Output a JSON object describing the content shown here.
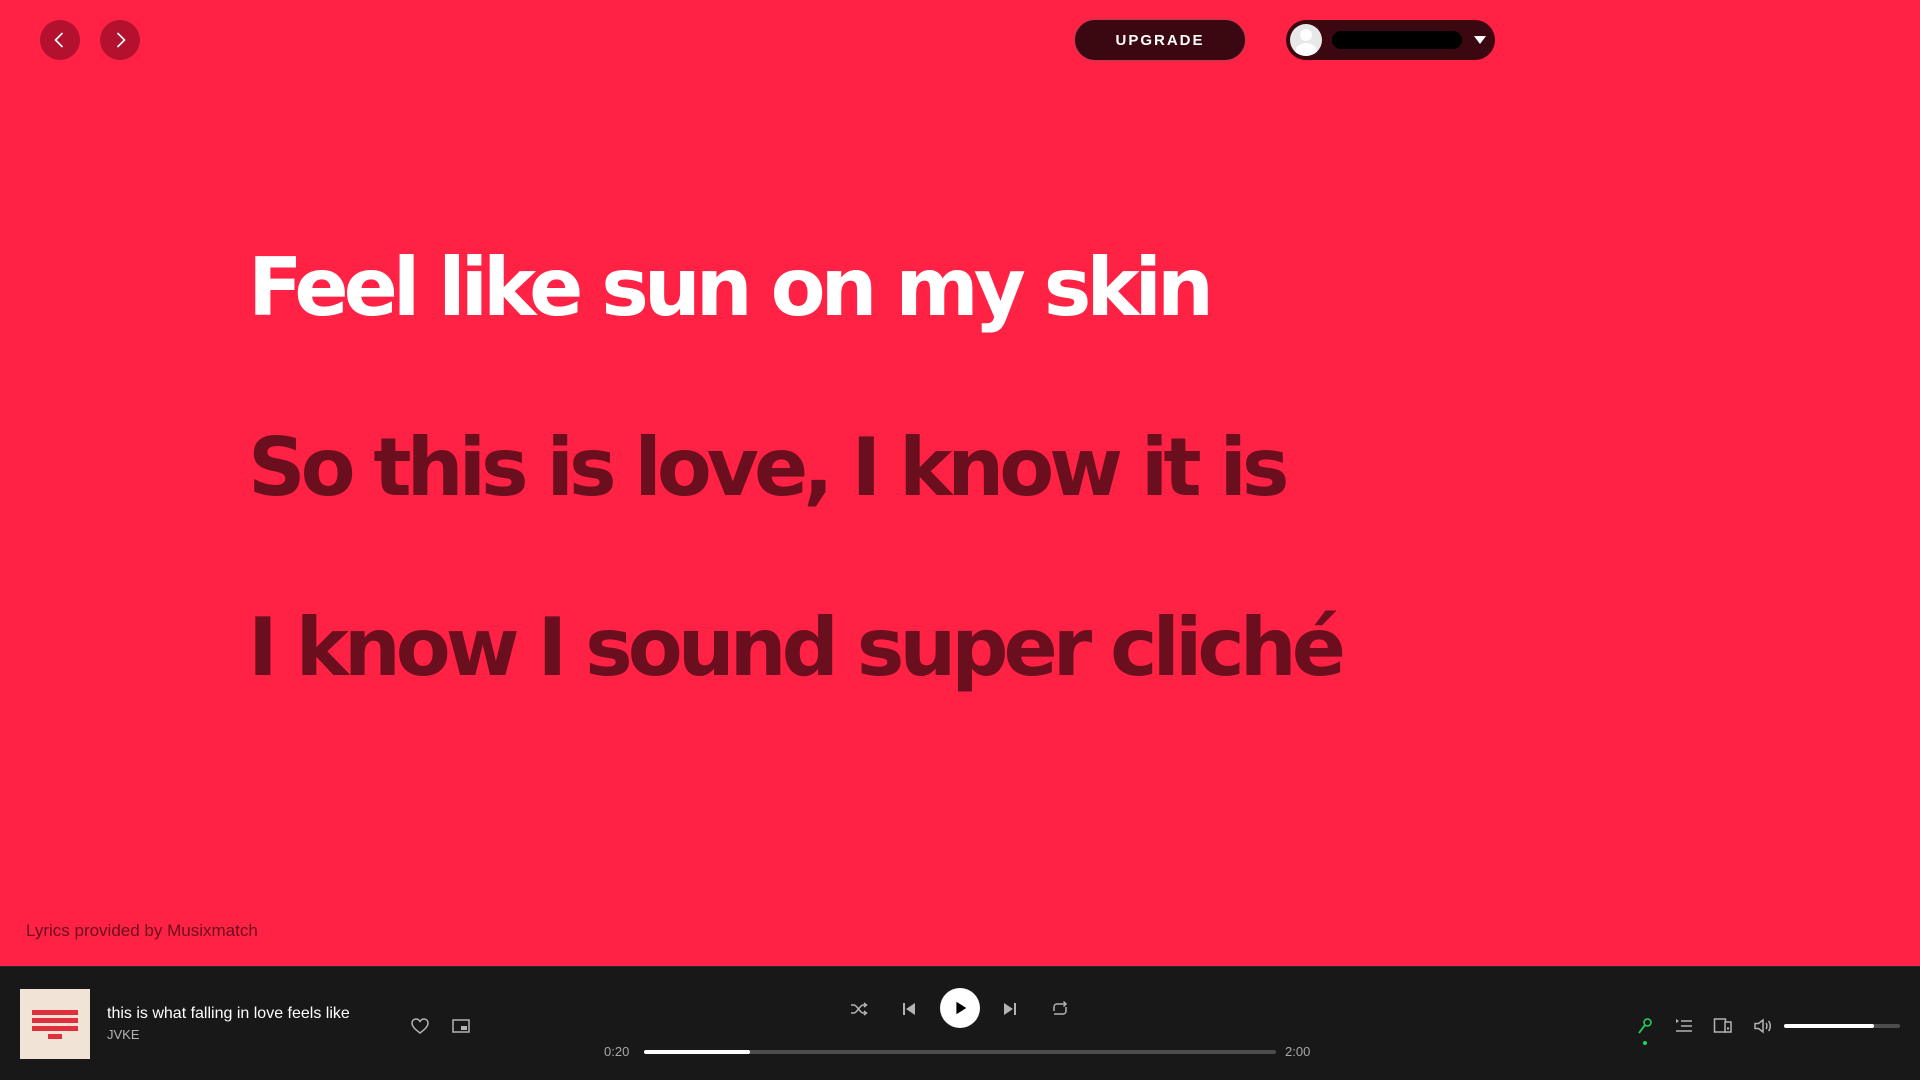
{
  "header": {
    "upgrade_label": "UPGRADE"
  },
  "lyrics": {
    "lines": [
      "Feel like sun on my skin",
      "So this is love, I know it is",
      "I know I sound super cliché"
    ],
    "credit": "Lyrics provided by Musixmatch",
    "colors": {
      "background": "#ff2245",
      "sung": "#ffffff",
      "upcoming": "#6b0e1e"
    }
  },
  "player": {
    "track_title": "this is what falling in love feels like",
    "artist": "JVKE",
    "time_elapsed": "0:20",
    "time_total": "2:00",
    "progress_fraction": 0.167,
    "volume_fraction": 0.78,
    "lyrics_active_color": "#1ed760",
    "icons": {
      "nav_back": "chevron-left-icon",
      "nav_forward": "chevron-right-icon",
      "like": "heart-icon",
      "pip": "picture-in-picture-icon",
      "shuffle": "shuffle-icon",
      "previous": "skip-back-icon",
      "play": "play-icon",
      "next": "skip-forward-icon",
      "repeat": "repeat-icon",
      "lyrics": "microphone-icon",
      "queue": "queue-icon",
      "devices": "devices-icon",
      "volume": "volume-icon"
    }
  }
}
